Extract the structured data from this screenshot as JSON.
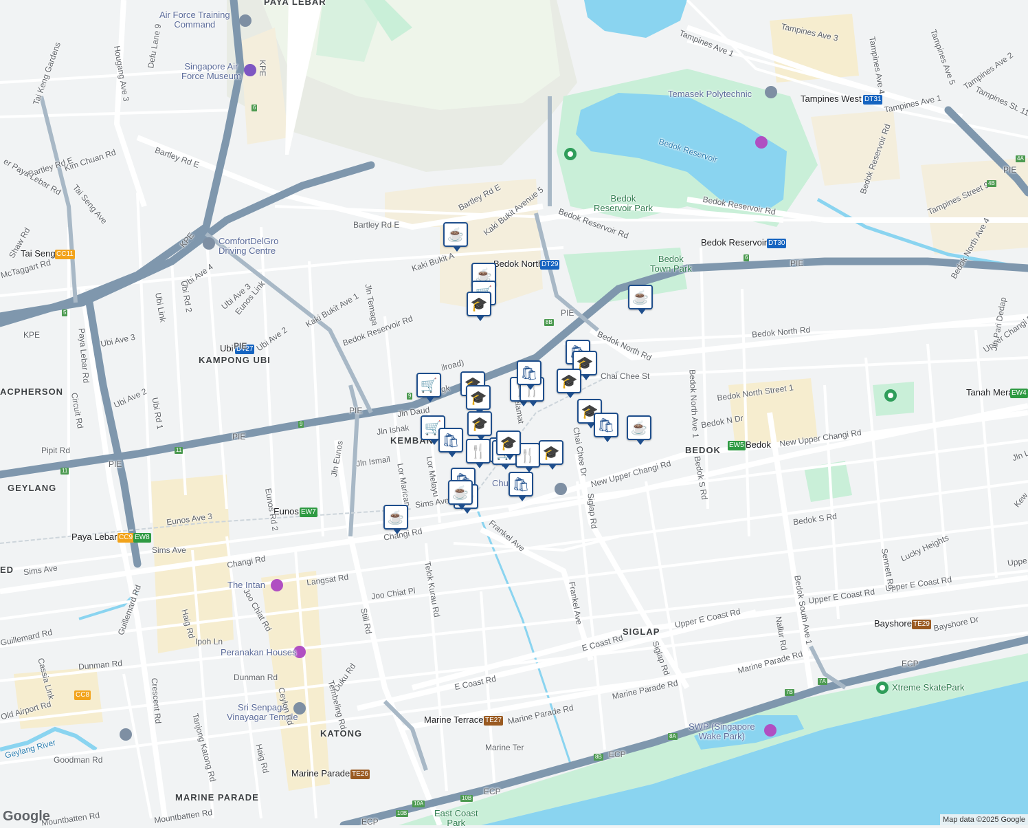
{
  "areas": {
    "paya_lebar": "PAYA LEBAR",
    "kampong_ubi": "KAMPONG UBI",
    "macpherson": "ACPHERSON",
    "geylang": "GEYLANG",
    "kembangan": "KEMBAN",
    "bedok": "BEDOK",
    "siglap": "SIGLAP",
    "katong": "KATONG",
    "marine_parade": "MARINE PARADE",
    "ed": "ED"
  },
  "pois": {
    "air_force_training": "Air Force Training\nCommand",
    "air_force_museum": "Singapore Air\nForce Museum",
    "comfortdelgro": "ComfortDelGro\nDriving Centre",
    "temasek_poly": "Temasek Polytechnic",
    "bedok_reservoir_park": "Bedok\nReservoir Park",
    "bedok_town_park": "Bedok\nTown Park",
    "the_intan": "The Intan",
    "peranakan_houses": "Peranakan Houses",
    "sri_senpaga": "Sri Senpaga\nVinayagar Temple",
    "swp": "SWP (Singapore\nWake Park)",
    "xtreme": "Xtreme SkatePark",
    "east_coast_park": "East Coast\nPark",
    "church": "Chu"
  },
  "water": {
    "bedok_reservoir": "Bedok Reservoir",
    "geylang_river": "Geylang River"
  },
  "stations": {
    "paya_lebar": {
      "name": "Paya Lebar",
      "codes": [
        "CC9",
        "EW8"
      ]
    },
    "eunos": {
      "name": "Eunos",
      "code": "EW7"
    },
    "ubi": {
      "name": "Ubi",
      "code": "DT27"
    },
    "bedok_north": {
      "name": "Bedok North",
      "code": "DT29"
    },
    "bedok_reservoir": {
      "name": "Bedok Reservoir",
      "code": "DT30"
    },
    "tampines_west": {
      "name": "Tampines West",
      "code": "DT31"
    },
    "tai_seng": {
      "name": "Tai Seng",
      "code": "CC11"
    },
    "bedok": {
      "name": "Bedok",
      "code": "EW5"
    },
    "marine_terrace": {
      "name": "Marine Terrace",
      "code": "TE27"
    },
    "marine_parade": {
      "name": "Marine Parade",
      "code": "TE26"
    },
    "bayshore": {
      "name": "Bayshore",
      "code": "TE29"
    },
    "dakota": {
      "code": "CC8"
    }
  },
  "roads": {
    "pie": "PIE",
    "kpe": "KPE",
    "ecp": "ECP",
    "changi_rd": "Changi Rd",
    "sims_ave": "Sims Ave",
    "new_upper_changi": "New Upper Changi Rd",
    "upper_e_coast": "Upper E Coast Rd",
    "e_coast_rd": "E Coast Rd",
    "marine_parade_rd": "Marine Parade Rd",
    "bedok_north_rd": "Bedok North Rd",
    "bedok_reservoir_rd": "Bedok Reservoir Rd",
    "bartley_rd_e": "Bartley Rd E",
    "kaki_bukit_ave_1": "Kaki Bukit Ave 1",
    "kaki_bukit_ave_5": "Kaki Bukit Avenue 5",
    "kaki_bukit": "Kaki Bukit A",
    "eunos_link": "Eunos Link",
    "jln_eunos": "Jln Eunos",
    "still_rd": "Still Rd",
    "frankel_ave": "Frankel Ave",
    "chai_chee_st": "Chai Chee St",
    "chai_chee_dr": "Chai Chee Dr",
    "siglap_rd": "Siglap Rd",
    "bedok_north_ave_1": "Bedok North Ave 1",
    "bedok_north_st_1": "Bedok North Street 1",
    "bedok_s_rd": "Bedok S Rd",
    "bedok_south_ave_1": "Bedok South Ave 1",
    "paya_lebar_rd": "Paya Lebar Rd",
    "hougang_ave_3": "Hougang Ave 3",
    "tampines_ave_1": "Tampines Ave 1",
    "tampines_ave_2": "Tampines Ave 2",
    "tampines_ave_3": "Tampines Ave 3",
    "tampines_ave_4": "Tampines Ave 4",
    "tampines_ave_5": "Tampines Ave 5",
    "tampines_st_11": "Tampines St. 11",
    "tampines_st_92": "Tampines Street 92",
    "bedok_reservoir_rd_e": "Bedok Reservoir Rd",
    "bedok_north_ave_4": "Bedok North Ave 4",
    "upper_changi_rd": "Upper Changi Rd",
    "tanah_merah": "Tanah Merah",
    "guillemard": "Guillemard Rd",
    "dunman_rd": "Dunman Rd",
    "haig_rd": "Haig Rd",
    "joo_chiat_rd": "Joo Chiat Rd",
    "tanjong_katong": "Tanjong Katong Rd",
    "telok_kurau": "Telok Kurau Rd",
    "langsat": "Langsat Rd",
    "joo_chiat_pl": "Joo Chiat Pl",
    "ubi_ave_2": "Ubi Ave 2",
    "ubi_ave_3": "Ubi Ave 3",
    "ubi_ave_4": "Ubi Ave 4",
    "ubi_rd_1": "Ubi Rd 1",
    "ubi_rd_2": "Ubi Rd 2",
    "ubi_link": "Ubi Link",
    "eunos_ave_3": "Eunos Ave 3",
    "eunos_rd_2": "Eunos Rd 2",
    "circuit_rd": "Circuit Rd",
    "pipit_rd": "Pipit Rd",
    "jln_ismail": "Jln Ismail",
    "jln_ishak": "Jln Ishak",
    "jln_daud": "Jln Daud",
    "jln_selamat": "Jln Selamat",
    "jln_temaga": "Jln Temaga",
    "lor_marican": "Lor Marican",
    "lor_melayu": "Lor Melayu",
    "bedok_reservoir_w": "Bedok Reservoir Rd",
    "bedok_n_dr": "Bedok N Dr",
    "bedok_s_rd2": "Bedok S Rd",
    "nallur_rd": "Nallur Rd",
    "sennett": "Sennett Rd",
    "lucky_heights": "Lucky Heights",
    "bayshore_dr": "Bayshore Dr",
    "marine_ter": "Marine Ter",
    "goodman": "Goodman Rd",
    "old_airport": "Old Airport Rd",
    "crescent": "Crescent Rd",
    "ipoh": "Ipoh Ln",
    "duku": "Duku Rd",
    "tembeling": "Tembeling Rd",
    "ceylon": "Ceylon Rd",
    "cassia": "Cassia Link",
    "mountbatten": "Mountbatten Rd",
    "bartley_rd_e2": "Bartley Rd E",
    "kim_chuan": "Kim Chuan Rd",
    "tai_seng_ave": "Tai Seng Ave",
    "shaw_rd": "Shaw Rd",
    "mctaggart": "McTaggart Rd",
    "tai_keng": "Tai Keng Gardens",
    "defu_lane_9": "Defu Lane 9",
    "upper_paya_lebar": "er Paya Lebar Rd",
    "jln_pari_dedap": "Jln Pari Dedap",
    "jln_lengkong": "Lengk",
    "kembangan_rail": "ilroad)",
    "jln_lima": "Jln Lima",
    "kew": "Kew",
    "upper_e_coast_2": "Upper E Coast Rd",
    "upper_e_coast_3": "Uppe"
  },
  "markers": [
    {
      "type": "cafe",
      "icon": "cup-icon"
    },
    {
      "type": "cafe",
      "icon": "cup-icon"
    },
    {
      "type": "grocery",
      "icon": "cart-icon"
    },
    {
      "type": "school",
      "icon": "graduation-cap-icon"
    },
    {
      "type": "cafe",
      "icon": "cup-icon"
    },
    {
      "type": "shop",
      "icon": "shopping-bag-icon"
    },
    {
      "type": "school",
      "icon": "graduation-cap-icon"
    },
    {
      "type": "school",
      "icon": "graduation-cap-icon"
    },
    {
      "type": "restaurant",
      "icon": "fork-knife-icon"
    },
    {
      "type": "restaurant",
      "icon": "fork-knife-icon"
    },
    {
      "type": "school",
      "icon": "graduation-cap-icon"
    },
    {
      "type": "shop",
      "icon": "shopping-bag-icon"
    },
    {
      "type": "school",
      "icon": "graduation-cap-icon"
    },
    {
      "type": "cafe",
      "icon": "cup-icon"
    },
    {
      "type": "grocery",
      "icon": "cart-icon"
    },
    {
      "type": "school",
      "icon": "graduation-cap-icon"
    },
    {
      "type": "school",
      "icon": "graduation-cap-icon"
    },
    {
      "type": "grocery",
      "icon": "cart-icon"
    },
    {
      "type": "grocery",
      "icon": "cart-icon"
    },
    {
      "type": "shop",
      "icon": "shopping-bag-icon"
    },
    {
      "type": "shop",
      "icon": "shopping-bag-icon"
    },
    {
      "type": "restaurant",
      "icon": "fork-knife-icon"
    },
    {
      "type": "school",
      "icon": "graduation-cap-icon"
    },
    {
      "type": "grocery",
      "icon": "cart-icon"
    },
    {
      "type": "restaurant",
      "icon": "fork-knife-icon"
    },
    {
      "type": "school",
      "icon": "graduation-cap-icon"
    },
    {
      "type": "shop",
      "icon": "shopping-bag-icon"
    },
    {
      "type": "shop",
      "icon": "shopping-bag-icon"
    },
    {
      "type": "cafe",
      "icon": "cup-icon"
    },
    {
      "type": "cafe",
      "icon": "cup-icon"
    },
    {
      "type": "cafe",
      "icon": "cup-icon"
    }
  ],
  "expressway_exits": [
    "6",
    "5",
    "11",
    "9",
    "8B",
    "4A",
    "4B",
    "7A",
    "7B",
    "8A",
    "8B",
    "10A",
    "10B",
    "6"
  ],
  "colors": {
    "land": "#f1f3f4",
    "water": "#8ad4f0",
    "park": "#c9efd8",
    "expressway": "#7f97ad",
    "road": "#ffffff",
    "marker_blue": "#1e4e8c",
    "station_ew": "#2e9a42",
    "station_dt": "#1664c0",
    "station_cc": "#f2a31b",
    "station_te": "#9a5a21"
  },
  "attribution": "Map data ©2025 Google",
  "logo": "Google"
}
